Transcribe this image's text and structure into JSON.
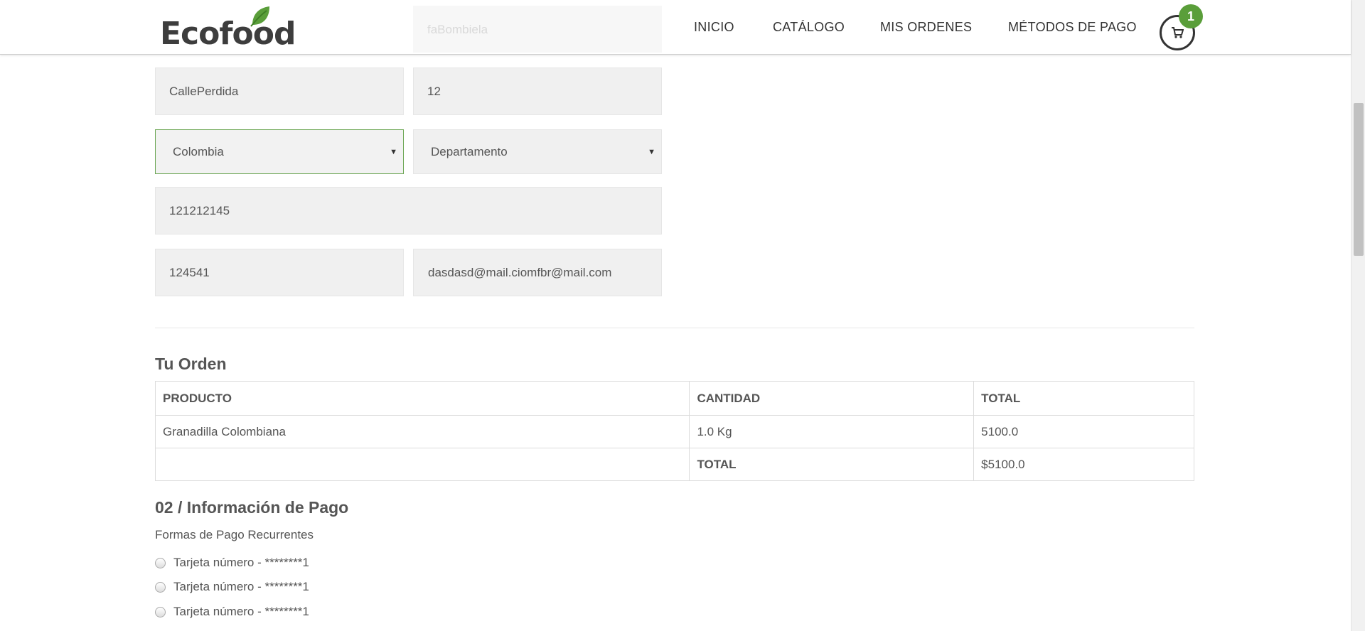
{
  "brand": {
    "name": "Ecofood",
    "leaf_color": "#5a9e3a"
  },
  "nav": [
    {
      "label": "INICIO"
    },
    {
      "label": "CATÁLOGO"
    },
    {
      "label": "MIS ORDENES"
    },
    {
      "label": "MÉTODOS DE PAGO"
    }
  ],
  "cart": {
    "count": "1",
    "icon": "shopping-cart-icon"
  },
  "form": {
    "partial_field": "faBombiela",
    "street": "CallePerdida",
    "number": "12",
    "country": "Colombia",
    "department": "Departamento",
    "phone": "121212145",
    "postal": "124541",
    "email": "dasdasd@mail.ciomfbr@mail.com"
  },
  "order": {
    "title": "Tu Orden",
    "headers": [
      "PRODUCTO",
      "CANTIDAD",
      "TOTAL"
    ],
    "items": [
      {
        "product": "Granadilla Colombiana",
        "quantity": "1.0 Kg",
        "total": "5100.0"
      }
    ],
    "total_label": "TOTAL",
    "total_value": "$5100.0"
  },
  "payment": {
    "title": "02 / Información de Pago",
    "subtitle": "Formas de Pago Recurrentes",
    "options": [
      "Tarjeta número - ********1",
      "Tarjeta número - ********1",
      "Tarjeta número - ********1"
    ]
  }
}
